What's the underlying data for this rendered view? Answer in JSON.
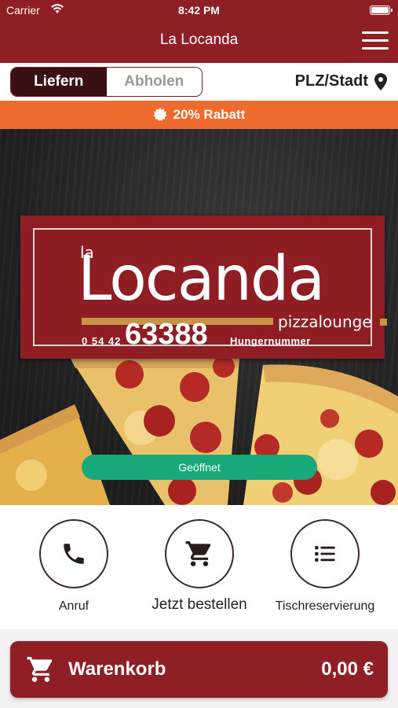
{
  "status_bar": {
    "carrier": "Carrier",
    "time": "8:42 PM"
  },
  "nav": {
    "title": "La Locanda",
    "menu_icon": "hamburger-menu-icon"
  },
  "mode_toggle": {
    "options": [
      {
        "label": "Liefern",
        "selected": true
      },
      {
        "label": "Abholen",
        "selected": false
      }
    ]
  },
  "location": {
    "label": "PLZ/Stadt",
    "icon": "map-pin-icon"
  },
  "discount": {
    "label": "20% Rabatt",
    "icon": "badge-icon"
  },
  "logo": {
    "la": "la",
    "name": "Locanda",
    "subtitle": "pizzalounge",
    "area_code": "0 54 42",
    "number": "63388",
    "tagline": "Hungernummer"
  },
  "status_pill": {
    "label": "Geöffnet"
  },
  "actions": [
    {
      "label": "Anruf",
      "icon": "phone-icon"
    },
    {
      "label": "Jetzt bestellen",
      "icon": "cart-icon"
    },
    {
      "label": "Tischreservierung",
      "icon": "list-icon"
    }
  ],
  "cart": {
    "label": "Warenkorb",
    "total": "0,00 €",
    "icon": "cart-icon"
  },
  "colors": {
    "brand": "#8f1f24",
    "discount": "#ef6a2d",
    "open": "#19a87a",
    "toggle_active": "#3a1013"
  }
}
